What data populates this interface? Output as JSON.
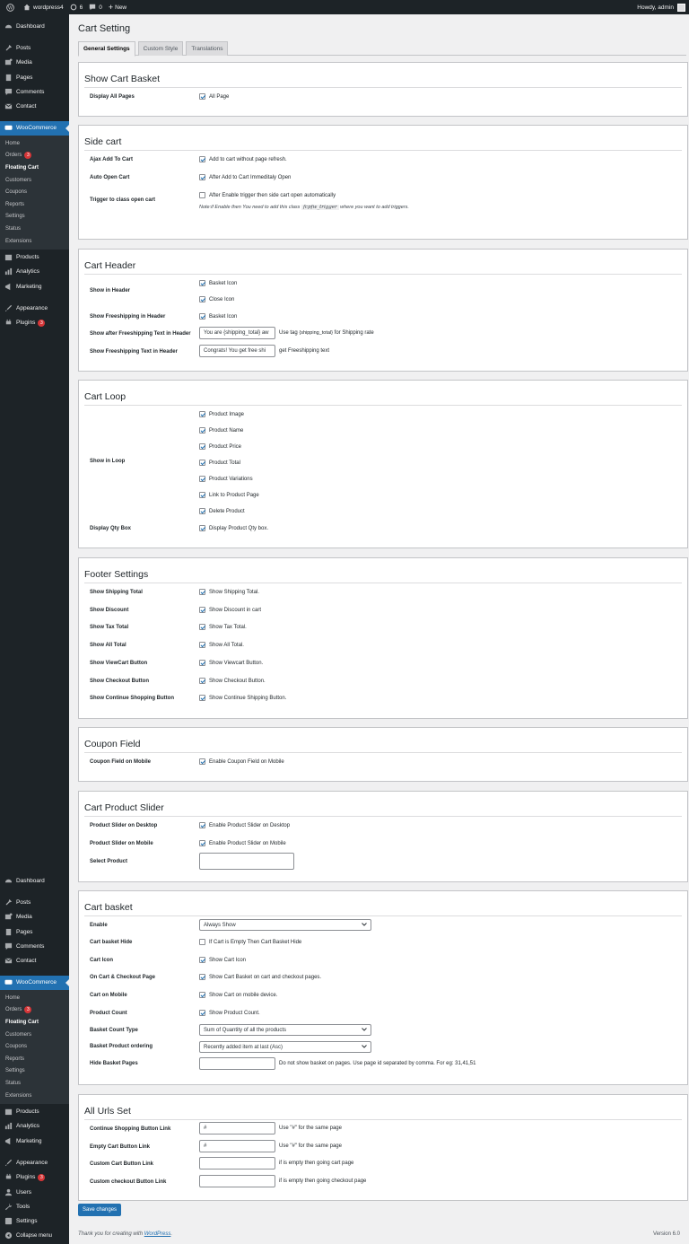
{
  "adminbar": {
    "site": "wordpress4",
    "updates": "6",
    "comments": "0",
    "new": "New",
    "howdy": "Howdy, admin"
  },
  "menu1": {
    "dashboard": "Dashboard",
    "posts": "Posts",
    "media": "Media",
    "pages": "Pages",
    "comments": "Comments",
    "contact": "Contact",
    "woocommerce": "WooCommerce",
    "sub": {
      "home": "Home",
      "orders": "Orders",
      "orders_badge": "3",
      "floating": "Floating Cart",
      "customers": "Customers",
      "coupons": "Coupons",
      "reports": "Reports",
      "settings": "Settings",
      "status": "Status",
      "extensions": "Extensions"
    },
    "products": "Products",
    "analytics": "Analytics",
    "marketing": "Marketing",
    "appearance": "Appearance",
    "plugins": "Plugins",
    "plugins_badge": "3"
  },
  "menu2": {
    "users": "Users",
    "tools": "Tools",
    "settings": "Settings",
    "collapse": "Collapse menu"
  },
  "page": {
    "title": "Cart Setting",
    "tabs": [
      "General Settings",
      "Custom Style",
      "Translations"
    ]
  },
  "s1": {
    "title": "Show Cart Basket",
    "display_all": "Display All Pages",
    "all_page": "All Page"
  },
  "s2": {
    "title": "Side cart",
    "ajax": "Ajax Add To Cart",
    "ajax_cb": "Add to cart without page refresh.",
    "auto": "Auto Open Cart",
    "auto_cb": "After Add to Cart Immeditaly Open",
    "trigger": "Trigger to class open cart",
    "trigger_cb": "After Enable trigger then side cart open automatically",
    "note_pre": "Note:if Enable then You need to add this class",
    "note_code": "fcpfw_trigger",
    "note_post": "where you want to add triggers."
  },
  "s3": {
    "title": "Cart Header",
    "show_header": "Show in Header",
    "basket_icon": "Basket Icon",
    "close_icon": "Close Icon",
    "free_header": "Show Freeshipping in Header",
    "free_basket": "Basket Icon",
    "after_free": "Show after Freeshipping Text in Header",
    "after_free_val": "You are {shipping_total} aw",
    "after_hint_pre": "Use tag",
    "after_hint_tag": "{shipping_total}",
    "after_hint_post": "for Shipping rate",
    "free_text": "Show Freeshipping Text in Header",
    "free_text_val": "Congrats! You get free shi",
    "free_text_hint": "get Freeshipping text"
  },
  "s4": {
    "title": "Cart Loop",
    "show_loop": "Show in Loop",
    "items": [
      "Product Image",
      "Product Name",
      "Product Price",
      "Product Total",
      "Product Variations",
      "Link to Product Page",
      "Delete Product"
    ],
    "qty": "Display Qty Box",
    "qty_cb": "Display Product Qty box."
  },
  "s5": {
    "title": "Footer Settings",
    "rows": [
      [
        "Show Shipping Total",
        "Show Shipping Total."
      ],
      [
        "Show Discount",
        "Show Discount in cart"
      ],
      [
        "Show Tax Total",
        "Show Tax Total."
      ],
      [
        "Show All Total",
        "Show All Total."
      ],
      [
        "Show ViewCart Button",
        "Show Viewcart Button."
      ],
      [
        "Show Checkout Button",
        "Show Checkout Button."
      ],
      [
        "Show Continue Shopping Button",
        "Show Continue Shipping Button."
      ]
    ]
  },
  "s6": {
    "title": "Coupon Field",
    "label": "Coupon Field on Mobile",
    "cb": "Enable Coupon Field on Mobile"
  },
  "s7": {
    "title": "Cart Product Slider",
    "desktop": "Product Slider on Desktop",
    "desktop_cb": "Enable Product Slider on Desktop",
    "mobile": "Product Slider on Mobile",
    "mobile_cb": "Enable Product Slider on Mobile",
    "select": "Select Product"
  },
  "s8": {
    "title": "Cart basket",
    "enable": "Enable",
    "enable_val": "Always Show",
    "hide": "Cart basket Hide",
    "hide_cb": "If Cart is Empty Then Cart Basket Hide",
    "icon": "Cart Icon",
    "icon_cb": "Show Cart Icon",
    "oncart": "On Cart & Checkout Page",
    "oncart_cb": "Show Cart Basket on cart and checkout pages.",
    "mobile": "Cart on Mobile",
    "mobile_cb": "Show Cart on mobile device.",
    "count": "Product Count",
    "count_cb": "Show Product Count.",
    "count_type": "Basket Count Type",
    "count_type_val": "Sum of Quantity of all the products",
    "ordering": "Basket Product ordering",
    "ordering_val": "Recently added item at last (Asc)",
    "hide_pages": "Hide Basket Pages",
    "hide_pages_hint": "Do not show basket on pages. Use page id separated by comma. For eg: 31,41,51"
  },
  "s9": {
    "title": "All Urls Set",
    "cont": "Continue Shopping Button Link",
    "cont_val": "#",
    "cont_hint": "Use \"#\" for the same page",
    "empty": "Empty Cart Button Link",
    "empty_val": "#",
    "empty_hint": "Use \"#\" for the same page",
    "custom_cart": "Custom Cart Button Link",
    "custom_cart_hint": "if is empty then going cart page",
    "custom_checkout": "Custom checkout Button Link",
    "custom_checkout_hint": "if is empty then going checkout page"
  },
  "save": "Save changes",
  "footer": {
    "thanks": "Thank you for creating with",
    "wp": "WordPress",
    "version": "Version 6.0"
  }
}
